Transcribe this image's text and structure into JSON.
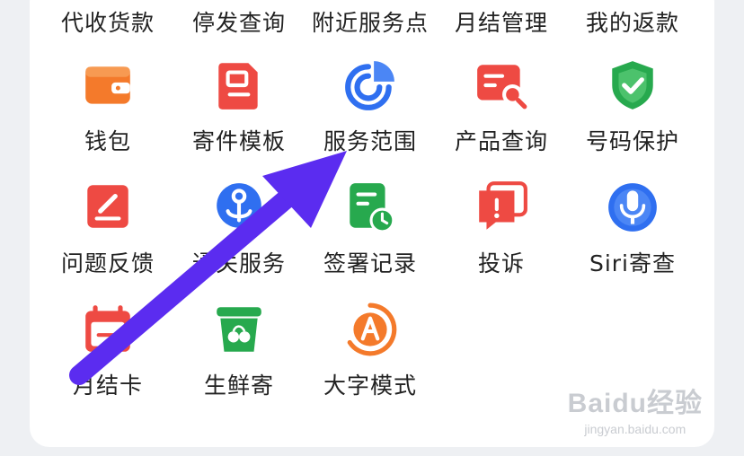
{
  "top_row": [
    {
      "label": "代收货款"
    },
    {
      "label": "停发查询"
    },
    {
      "label": "附近服务点"
    },
    {
      "label": "月结管理"
    },
    {
      "label": "我的返款"
    }
  ],
  "grid": [
    {
      "label": "钱包",
      "icon": "wallet-icon",
      "color": "#f47a2b"
    },
    {
      "label": "寄件模板",
      "icon": "template-icon",
      "color": "#ee4a43"
    },
    {
      "label": "服务范围",
      "icon": "pie-chart-icon",
      "color": "#2f6ff0"
    },
    {
      "label": "产品查询",
      "icon": "product-search-icon",
      "color": "#ee4a43"
    },
    {
      "label": "号码保护",
      "icon": "shield-check-icon",
      "color": "#27a94e"
    },
    {
      "label": "问题反馈",
      "icon": "feedback-icon",
      "color": "#ee4a43"
    },
    {
      "label": "通关服务",
      "icon": "customs-icon",
      "color": "#2f6ff0"
    },
    {
      "label": "签署记录",
      "icon": "sign-record-icon",
      "color": "#27a94e"
    },
    {
      "label": "投诉",
      "icon": "complaint-icon",
      "color": "#ee4a43"
    },
    {
      "label": "Siri寄查",
      "icon": "microphone-icon",
      "color": "#2f6ff0"
    },
    {
      "label": "月结卡",
      "icon": "calendar-card-icon",
      "color": "#ee4a43"
    },
    {
      "label": "生鲜寄",
      "icon": "fresh-basket-icon",
      "color": "#27a94e"
    },
    {
      "label": "大字模式",
      "icon": "large-font-icon",
      "color": "#f47a2b"
    }
  ],
  "watermark": {
    "brand": "Baidu经验",
    "url": "jingyan.baidu.com"
  },
  "annotation": {
    "color": "#5b2cf0"
  }
}
